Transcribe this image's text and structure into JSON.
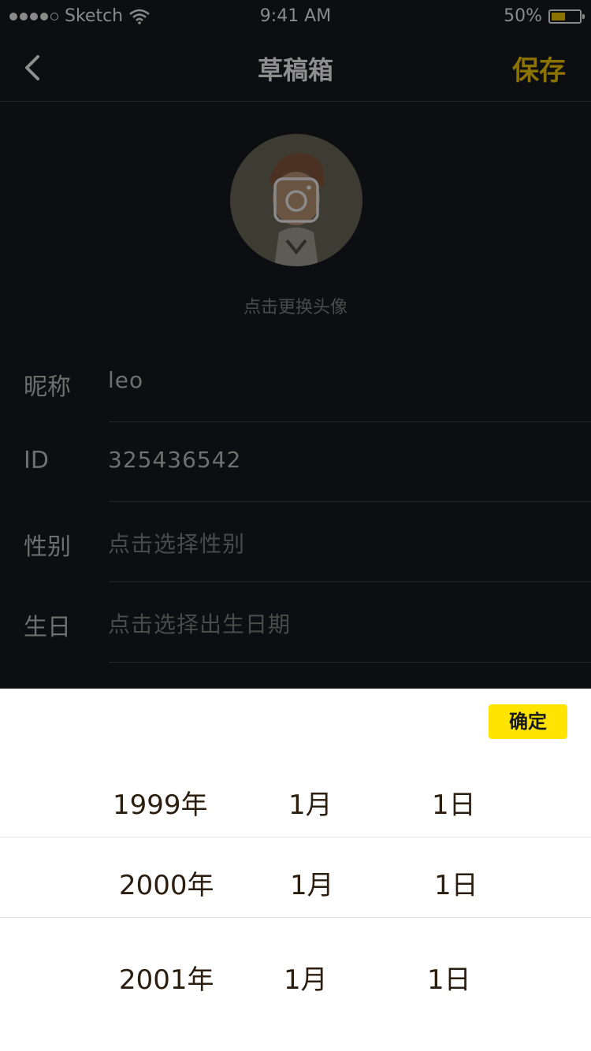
{
  "status_bar": {
    "carrier": "Sketch",
    "time": "9:41 AM",
    "battery": "50%",
    "battery_level": 0.5
  },
  "nav": {
    "title": "草稿箱",
    "save_label": "保存",
    "back_icon": "chevron-left-icon"
  },
  "avatar": {
    "hint": "点击更换头像",
    "camera_icon": "camera-icon"
  },
  "form": [
    {
      "label": "昵称",
      "value": "leo",
      "placeholder": ""
    },
    {
      "label": "ID",
      "value": "325436542",
      "placeholder": ""
    },
    {
      "label": "性别",
      "value": "",
      "placeholder": "点击选择性别"
    },
    {
      "label": "生日",
      "value": "",
      "placeholder": "点击选择出生日期"
    }
  ],
  "picker": {
    "confirm_label": "确定",
    "rows": [
      {
        "year": "1999年",
        "month": "1月",
        "day": "1日"
      },
      {
        "year": "2000年",
        "month": "1月",
        "day": "1日"
      },
      {
        "year": "2001年",
        "month": "1月",
        "day": "1日"
      }
    ]
  },
  "colors": {
    "accent": "#ffe400",
    "save_text": "#8b7300",
    "background": "#0d0e12"
  }
}
